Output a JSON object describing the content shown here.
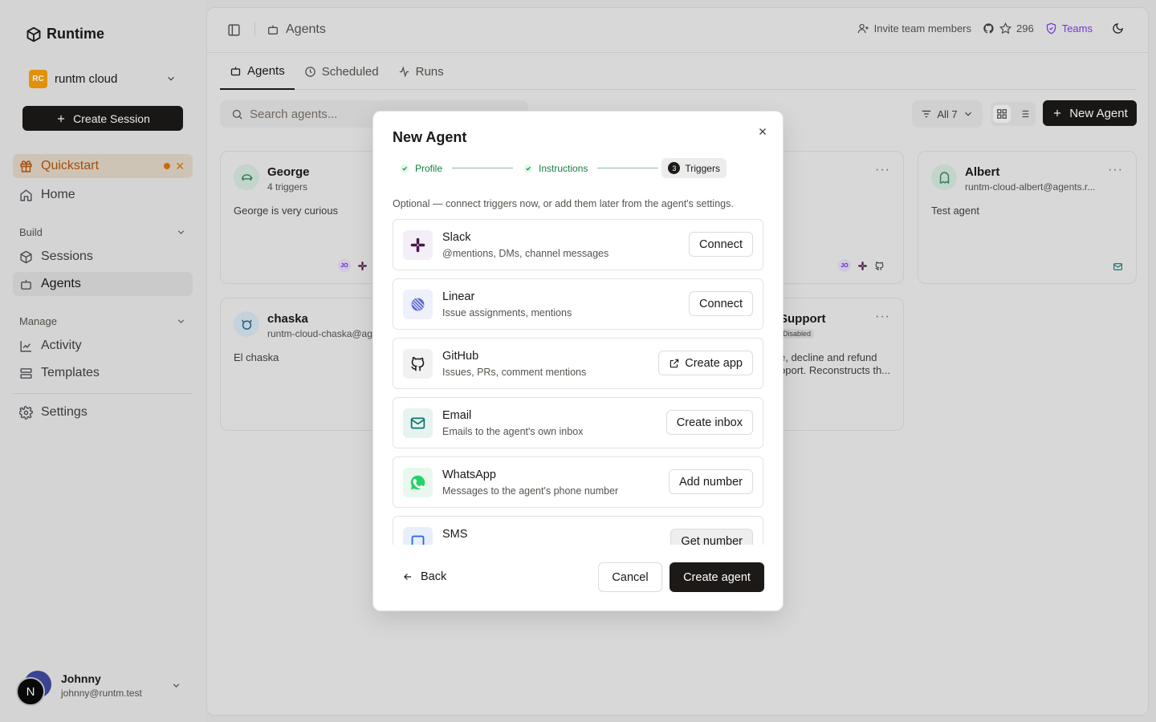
{
  "app": {
    "name": "Runtime"
  },
  "org": {
    "badge": "RC",
    "name": "runtm cloud"
  },
  "sidebar": {
    "create_session": "Create Session",
    "quickstart": "Quickstart",
    "home": "Home",
    "build_label": "Build",
    "sessions": "Sessions",
    "agents": "Agents",
    "manage_label": "Manage",
    "activity": "Activity",
    "templates": "Templates",
    "settings": "Settings"
  },
  "user": {
    "initial": "N",
    "name": "Johnny",
    "email": "johnny@runtm.test"
  },
  "topbar": {
    "breadcrumb": "Agents",
    "invite": "Invite team members",
    "stars": "296",
    "teams": "Teams"
  },
  "tabs": [
    "Agents",
    "Scheduled",
    "Runs"
  ],
  "toolbar": {
    "search_placeholder": "Search agents...",
    "filter_label": "All 7",
    "new_agent": "New Agent"
  },
  "cards": {
    "george": {
      "name": "George",
      "sub": "4 triggers",
      "desc": "George is very curious",
      "avatar_initials": "JO"
    },
    "albert": {
      "name": "Albert",
      "sub": "runtm-cloud-albert@agents.r...",
      "desc": "Test agent"
    },
    "chaska": {
      "name": "chaska",
      "sub": "runtm-cloud-chaska@age",
      "desc": "El chaska"
    },
    "middle_top": {
      "avatar_initials": "JO"
    },
    "support": {
      "name": "Support",
      "badge": "Disabled",
      "desc_line1": "e, decline and refund",
      "desc_line2": "pport. Reconstructs th..."
    }
  },
  "modal": {
    "title": "New Agent",
    "steps": [
      {
        "label": "Profile",
        "state": "done"
      },
      {
        "label": "Instructions",
        "state": "done"
      },
      {
        "label": "Triggers",
        "state": "current",
        "number": "3"
      }
    ],
    "subtitle": "Optional — connect triggers now, or add them later from the agent's settings.",
    "triggers": [
      {
        "name": "Slack",
        "desc": "@mentions, DMs, channel messages",
        "action": "Connect",
        "icon": "slack-icon"
      },
      {
        "name": "Linear",
        "desc": "Issue assignments, mentions",
        "action": "Connect",
        "icon": "linear-icon"
      },
      {
        "name": "GitHub",
        "desc": "Issues, PRs, comment mentions",
        "action": "Create app",
        "icon": "github-icon"
      },
      {
        "name": "Email",
        "desc": "Emails to the agent's own inbox",
        "action": "Create inbox",
        "icon": "mail-icon"
      },
      {
        "name": "WhatsApp",
        "desc": "Messages to the agent's phone number",
        "action": "Add number",
        "icon": "whatsapp-icon"
      },
      {
        "name": "SMS",
        "desc": "",
        "action": "Get number",
        "icon": "sms-icon"
      }
    ],
    "back": "Back",
    "cancel": "Cancel",
    "create": "Create agent"
  },
  "colors": {
    "brand_dark": "#1c1917",
    "quickstart_accent": "#b45309",
    "teams_purple": "#7c3aed",
    "step_done_green": "#15803d",
    "whatsapp_green": "#25d366"
  }
}
